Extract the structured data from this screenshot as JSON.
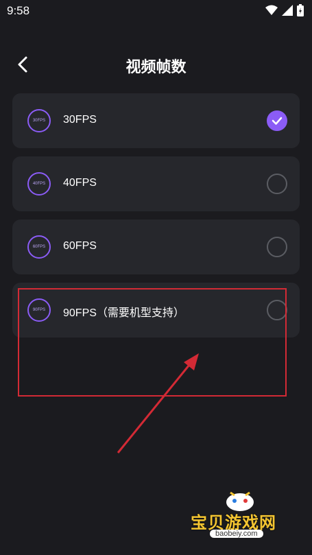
{
  "status_bar": {
    "time": "9:58"
  },
  "header": {
    "title": "视频帧数"
  },
  "options": [
    {
      "badge": "30FPS",
      "label": "30FPS",
      "selected": true
    },
    {
      "badge": "40FPS",
      "label": "40FPS",
      "selected": false
    },
    {
      "badge": "60FPS",
      "label": "60FPS",
      "selected": false
    },
    {
      "badge": "90FPS",
      "label": "90FPS（需要机型支持）",
      "selected": false
    }
  ],
  "watermark": {
    "name": "宝贝游戏网",
    "url": "baobeiy.com"
  },
  "colors": {
    "accent": "#8b5cf6",
    "background": "#1b1b1f",
    "card": "#26272c",
    "annotation": "#d32a35"
  }
}
